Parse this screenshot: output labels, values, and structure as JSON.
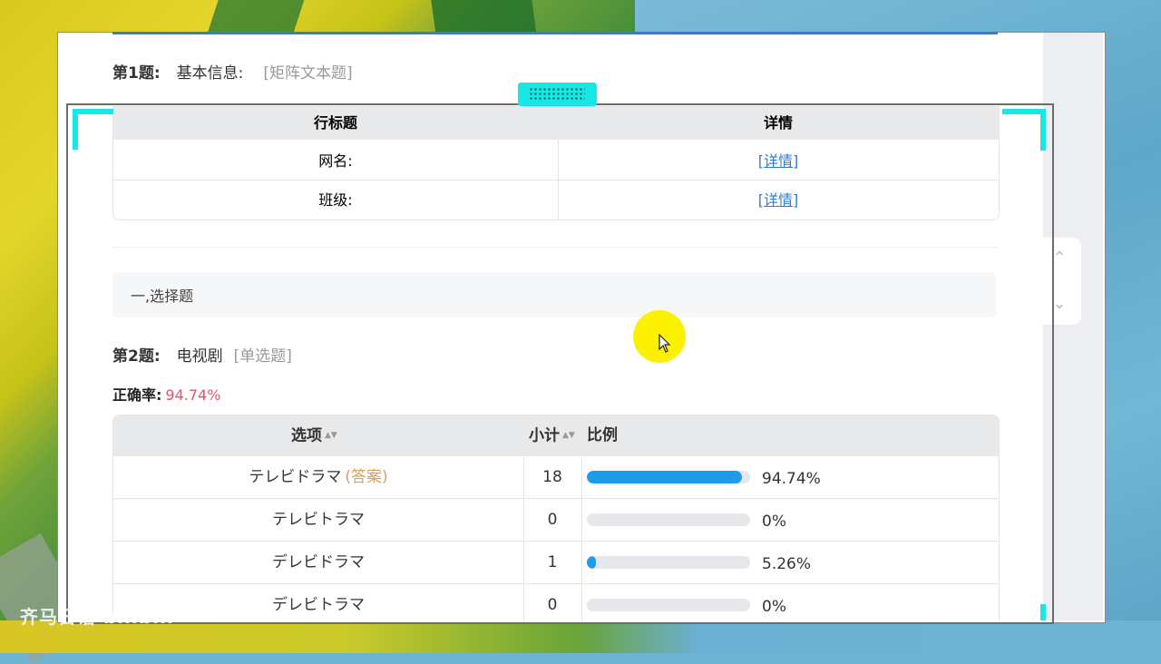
{
  "question1": {
    "number": "第1题:",
    "title": "基本信息:",
    "type": "[矩阵文本题]",
    "table": {
      "headers": [
        "行标题",
        "详情"
      ],
      "rows": [
        {
          "label": "网名:",
          "link": "[详情]"
        },
        {
          "label": "班级:",
          "link": "[详情]"
        }
      ]
    }
  },
  "section": {
    "label": "一,选择题"
  },
  "question2": {
    "number": "第2题:",
    "title": "电视剧",
    "type": "[单选题]",
    "accuracy_label": "正确率:",
    "accuracy_value": "94.74%",
    "table": {
      "headers": {
        "option": "选项",
        "count": "小计",
        "ratio": "比例"
      },
      "rows": [
        {
          "option": "テレビドラマ",
          "answer_tag": "(答案)",
          "count": "18",
          "ratio": 0.9474,
          "percent": "94.74%"
        },
        {
          "option": "テレビトラマ",
          "answer_tag": "",
          "count": "0",
          "ratio": 0,
          "percent": "0%"
        },
        {
          "option": "デレビドラマ",
          "answer_tag": "",
          "count": "1",
          "ratio": 0.0526,
          "percent": "5.26%"
        },
        {
          "option": "デレビトラマ",
          "answer_tag": "",
          "count": "0",
          "ratio": 0,
          "percent": "0%"
        }
      ]
    }
  },
  "watermark": "齐马日语 bilibili",
  "colors": {
    "accent": "#1f9be8",
    "accuracy": "#e1546a",
    "answer": "#d6a25a",
    "link": "#2b7cd3",
    "capture": "#16e8e5"
  }
}
